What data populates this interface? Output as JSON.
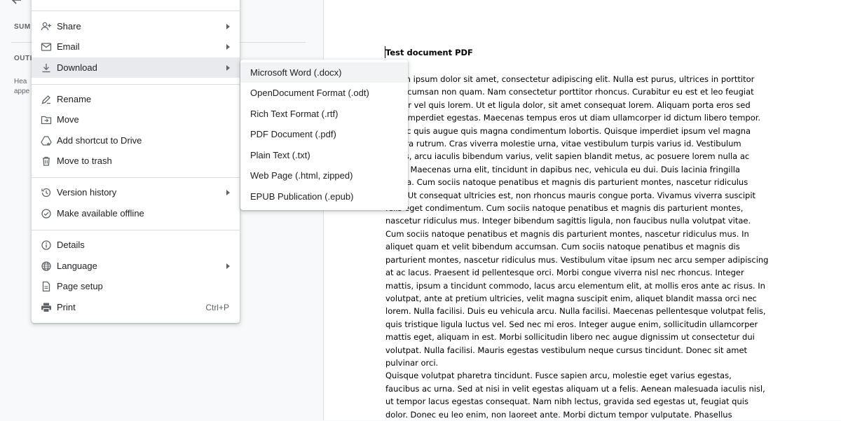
{
  "sidebar": {
    "summary_label": "SUM",
    "outline_label": "OUTL",
    "outline_hint_1": "Hea",
    "outline_hint_2": "appe"
  },
  "file_menu": {
    "items": [
      {
        "label": "Share",
        "icon": "person-add-icon",
        "submenu": true
      },
      {
        "label": "Email",
        "icon": "email-icon",
        "submenu": true
      },
      {
        "label": "Download",
        "icon": "download-icon",
        "submenu": true,
        "active": true
      },
      {
        "label": "Rename",
        "icon": "rename-icon"
      },
      {
        "label": "Move",
        "icon": "move-folder-icon"
      },
      {
        "label": "Add shortcut to Drive",
        "icon": "drive-shortcut-icon"
      },
      {
        "label": "Move to trash",
        "icon": "trash-icon"
      },
      {
        "label": "Version history",
        "icon": "history-icon",
        "submenu": true
      },
      {
        "label": "Make available offline",
        "icon": "offline-icon"
      },
      {
        "label": "Details",
        "icon": "info-icon"
      },
      {
        "label": "Language",
        "icon": "globe-icon",
        "submenu": true
      },
      {
        "label": "Page setup",
        "icon": "page-setup-icon"
      },
      {
        "label": "Print",
        "icon": "print-icon",
        "shortcut": "Ctrl+P"
      }
    ]
  },
  "download_submenu": {
    "items": [
      {
        "label": "Microsoft Word (.docx)",
        "highlighted": true
      },
      {
        "label": "OpenDocument Format (.odt)"
      },
      {
        "label": "Rich Text Format (.rtf)"
      },
      {
        "label": "PDF Document (.pdf)"
      },
      {
        "label": "Plain Text (.txt)"
      },
      {
        "label": "Web Page (.html, zipped)"
      },
      {
        "label": "EPUB Publication (.epub)"
      }
    ]
  },
  "document": {
    "title": "Test document PDF",
    "body_lines": [
      "Lorem ipsum dolor sit amet, consectetur adipiscing elit. Nulla est purus, ultrices in porttitor",
      "in, accumsan non quam. Nam consectetur porttitor rhoncus. Curabitur eu est et leo feugiat",
      "auctor vel quis lorem. Ut et ligula dolor, sit amet consequat lorem. Aliquam porta eros sed",
      "velit imperdiet egestas. Maecenas tempus eros ut diam ullamcorper id dictum libero tempor.",
      "Donec quis augue quis magna condimentum lobortis. Quisque imperdiet ipsum vel magna",
      "viverra rutrum. Cras viverra molestie urna, vitae vestibulum turpis varius id. Vestibulum",
      "mollis, arcu iaculis bibendum varius, velit sapien blandit metus, ac posuere lorem nulla ac",
      "dolor. Maecenas urna elit, tincidunt in dapibus nec, vehicula eu dui. Duis lacinia fringilla",
      "massa. Cum sociis natoque penatibus et magnis dis parturient montes, nascetur ridiculus",
      "mus. Ut consequat ultricies est, non rhoncus mauris congue porta. Vivamus viverra suscipit",
      "felis eget condimentum. Cum sociis natoque penatibus et magnis dis parturient montes,",
      "nascetur ridiculus mus. Integer bibendum sagittis ligula, non faucibus nulla volutpat vitae.",
      "Cum sociis natoque penatibus et magnis dis parturient montes, nascetur ridiculus mus.   In",
      "aliquet quam et velit bibendum accumsan. Cum sociis natoque penatibus et magnis dis",
      "parturient montes, nascetur ridiculus mus. Vestibulum vitae ipsum nec arcu semper adipiscing",
      "at ac lacus. Praesent id pellentesque orci. Morbi congue viverra nisl nec rhoncus. Integer",
      "mattis, ipsum a tincidunt commodo, lacus arcu elementum elit, at mollis eros ante ac risus. In",
      "volutpat, ante at pretium ultricies, velit magna suscipit enim, aliquet blandit massa orci nec",
      "lorem. Nulla facilisi. Duis eu vehicula arcu. Nulla facilisi. Maecenas pellentesque volutpat felis,",
      "quis tristique ligula luctus vel. Sed nec mi eros. Integer augue enim, sollicitudin ullamcorper",
      "mattis eget, aliquam in est. Morbi sollicitudin libero nec augue dignissim ut consectetur dui",
      "volutpat. Nulla facilisi. Mauris egestas vestibulum neque cursus tincidunt. Donec sit amet",
      "pulvinar orci.",
      "Quisque volutpat pharetra tincidunt. Fusce sapien arcu, molestie eget varius egestas,",
      "faucibus ac urna. Sed at nisi in velit egestas aliquam ut a felis. Aenean malesuada iaculis nisl,",
      "ut tempor lacus egestas consequat. Nam nibh lectus, gravida sed egestas ut, feugiat quis",
      "dolor. Donec eu leo enim, non laoreet ante. Morbi dictum tempor vulputate. Phasellus"
    ]
  },
  "colors": {
    "menu_bg": "#ffffff",
    "active_item_bg": "#e8eaed",
    "highlight_item_bg": "#f1f3f4",
    "page_bg": "#f8f9fa",
    "icon_color": "#5f6368"
  }
}
